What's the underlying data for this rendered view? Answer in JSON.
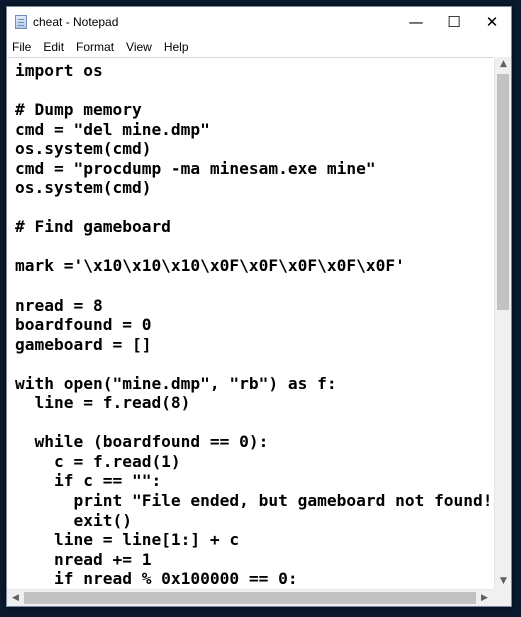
{
  "window": {
    "title": "cheat - Notepad",
    "minimize_glyph": "—",
    "maximize_glyph": "☐",
    "close_glyph": "✕"
  },
  "menu": {
    "file": "File",
    "edit": "Edit",
    "format": "Format",
    "view": "View",
    "help": "Help"
  },
  "editor": {
    "lines": [
      "import os",
      "",
      "# Dump memory",
      "cmd = \"del mine.dmp\"",
      "os.system(cmd)",
      "cmd = \"procdump -ma minesam.exe mine\"",
      "os.system(cmd)",
      "",
      "# Find gameboard",
      "",
      "mark ='\\x10\\x10\\x10\\x0F\\x0F\\x0F\\x0F\\x0F'",
      "",
      "nread = 8",
      "boardfound = 0",
      "gameboard = []",
      "",
      "with open(\"mine.dmp\", \"rb\") as f:",
      "  line = f.read(8)",
      "",
      "  while (boardfound == 0):",
      "    c = f.read(1)",
      "    if c == \"\":",
      "      print \"File ended, but gameboard not found!\"",
      "      exit()",
      "    line = line[1:] + c",
      "    nread += 1",
      "    if nread % 0x100000 == 0:"
    ]
  },
  "scrollbars": {
    "up_arrow": "▲",
    "down_arrow": "▼",
    "left_arrow": "◀",
    "right_arrow": "▶"
  }
}
